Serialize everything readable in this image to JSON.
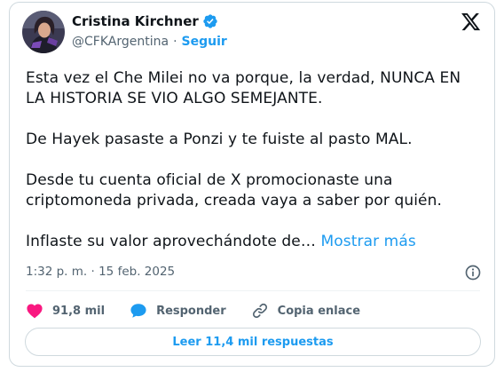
{
  "author": {
    "name": "Cristina Kirchner",
    "handle": "@CFKArgentina",
    "separator": "·",
    "follow_label": "Seguir",
    "verified": true
  },
  "platform_icon": "x-logo-icon",
  "tweet": {
    "paragraphs": [
      "Esta vez el Che Milei no va porque, la verdad, NUNCA EN LA HISTORIA SE VIO ALGO SEMEJANTE.",
      "De Hayek pasaste a Ponzi y te fuiste al pasto MAL.",
      "Desde tu cuenta oficial de X promocionaste una criptomoneda privada, creada vaya a saber por quién."
    ],
    "truncated_text": "Inflaste su valor aprovechándote de…",
    "show_more_label": "Mostrar más"
  },
  "meta": {
    "time": "1:32 p. m.",
    "separator": "·",
    "date": "15 feb. 2025"
  },
  "actions": {
    "likes": "91,8 mil",
    "reply_label": "Responder",
    "copy_link_label": "Copia enlace"
  },
  "replies_button": "Leer 11,4 mil respuestas",
  "colors": {
    "accent": "#1d9bf0",
    "like": "#f91880",
    "muted": "#536471",
    "border": "#cfd9de"
  }
}
